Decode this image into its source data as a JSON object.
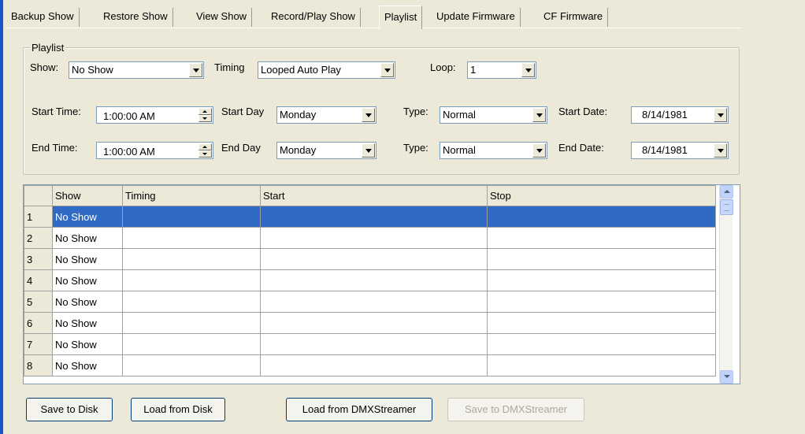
{
  "tabs": [
    {
      "label": "Backup Show"
    },
    {
      "label": "Restore Show"
    },
    {
      "label": "View Show"
    },
    {
      "label": "Record/Play Show"
    },
    {
      "label": "Playlist",
      "active": true
    },
    {
      "label": "Update Firmware"
    },
    {
      "label": "CF Firmware"
    }
  ],
  "playlist": {
    "group_title": "Playlist",
    "show_label": "Show:",
    "show_value": "No Show",
    "timing_label": "Timing",
    "timing_value": "Looped Auto Play",
    "loop_label": "Loop:",
    "loop_value": "1",
    "start_time_label": "Start Time:",
    "start_time_value": "1:00:00 AM",
    "start_day_label": "Start Day",
    "start_day_value": "Monday",
    "start_type_label": "Type:",
    "start_type_value": "Normal",
    "start_date_label": "Start Date:",
    "start_date_value": "8/14/1981",
    "end_time_label": "End Time:",
    "end_time_value": "1:00:00 AM",
    "end_day_label": "End Day",
    "end_day_value": "Monday",
    "end_type_label": "Type:",
    "end_type_value": "Normal",
    "end_date_label": "End Date:",
    "end_date_value": "8/14/1981"
  },
  "grid": {
    "columns": [
      "Show",
      "Timing",
      "Start",
      "Stop"
    ],
    "rows": [
      {
        "num": "1",
        "show": "No Show",
        "selected": true
      },
      {
        "num": "2",
        "show": "No Show"
      },
      {
        "num": "3",
        "show": "No Show"
      },
      {
        "num": "4",
        "show": "No Show"
      },
      {
        "num": "5",
        "show": "No Show"
      },
      {
        "num": "6",
        "show": "No Show"
      },
      {
        "num": "7",
        "show": "No Show"
      },
      {
        "num": "8",
        "show": "No Show"
      }
    ]
  },
  "buttons": {
    "save_disk": "Save to Disk",
    "load_disk": "Load from Disk",
    "load_dmx": "Load from DMXStreamer",
    "save_dmx": "Save to DMXStreamer"
  },
  "colors": {
    "selection": "#316ac5",
    "face": "#ece9d8",
    "disabled_text": "#aca899"
  }
}
